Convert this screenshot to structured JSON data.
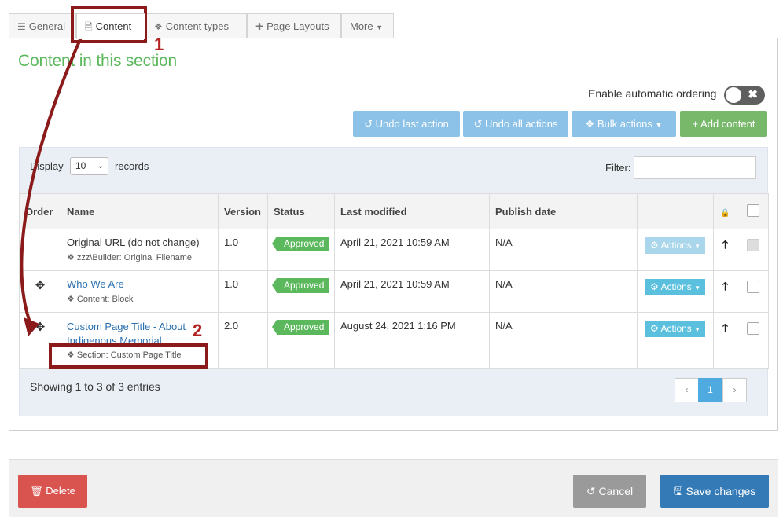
{
  "tabs": [
    {
      "label": "General",
      "icon": "sliders-icon"
    },
    {
      "label": "Content",
      "icon": "document-icon"
    },
    {
      "label": "Content types",
      "icon": "cubes-icon"
    },
    {
      "label": "Page Layouts",
      "icon": "puzzle-icon"
    },
    {
      "label": "More",
      "icon": "caret-down-icon"
    }
  ],
  "section_title": "Content in this section",
  "auto_order": {
    "label": "Enable automatic ordering",
    "toggle_symbol": "✖"
  },
  "toolbar": {
    "undo_last": "Undo last action",
    "undo_all": "Undo all actions",
    "bulk": "Bulk actions",
    "add": "+ Add content"
  },
  "table_controls": {
    "display_label": "Display",
    "page_size": "10",
    "records_label": "records",
    "filter_label": "Filter:"
  },
  "columns": [
    "Order",
    "Name",
    "Version",
    "Status",
    "Last modified",
    "Publish date"
  ],
  "rows": [
    {
      "name": "Original URL (do not change)",
      "type": "zzz\\Builder: Original Filename",
      "version": "1.0",
      "status": "Approved",
      "modified": "April 21, 2021 10:59 AM",
      "publish": "N/A",
      "actions": "Actions"
    },
    {
      "name": "Who We Are",
      "type": "Content: Block",
      "version": "1.0",
      "status": "Approved",
      "modified": "April 21, 2021 10:59 AM",
      "publish": "N/A",
      "actions": "Actions"
    },
    {
      "name": "Custom Page Title - About Indigenous Memorial",
      "type": "Section: Custom Page Title",
      "version": "2.0",
      "status": "Approved",
      "modified": "August 24, 2021 1:16 PM",
      "publish": "N/A",
      "actions": "Actions"
    }
  ],
  "showing": "Showing 1 to 3 of 3 entries",
  "pagination": {
    "prev": "‹",
    "current": "1",
    "next": "›"
  },
  "footer": {
    "delete": "Delete",
    "cancel": "Cancel",
    "save": "Save changes"
  },
  "annotations": {
    "one": "1",
    "two": "2"
  },
  "colors": {
    "accent_green": "#5cb85c",
    "annotation": "#8b1a1a",
    "primary": "#337ab7",
    "danger": "#d9534f"
  }
}
